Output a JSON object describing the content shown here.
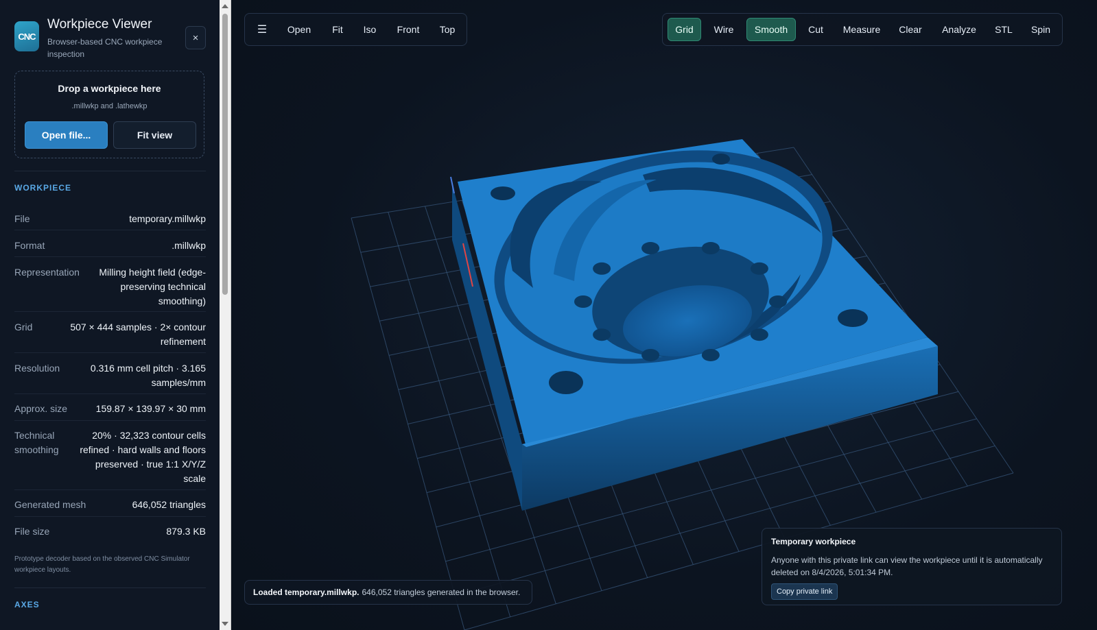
{
  "app": {
    "logo_text": "CNC",
    "title": "Workpiece Viewer",
    "subtitle": "Browser-based CNC workpiece inspection",
    "close_symbol": "×"
  },
  "dropzone": {
    "title": "Drop a workpiece here",
    "subtitle": ".millwkp and .lathewkp",
    "open_label": "Open file...",
    "fit_label": "Fit view"
  },
  "workpiece": {
    "heading": "WORKPIECE",
    "rows": [
      {
        "key": "File",
        "value": "temporary.millwkp"
      },
      {
        "key": "Format",
        "value": ".millwkp"
      },
      {
        "key": "Representation",
        "value": "Milling height field (edge-preserving technical smoothing)"
      },
      {
        "key": "Grid",
        "value": "507 × 444 samples · 2× contour refinement"
      },
      {
        "key": "Resolution",
        "value": "0.316 mm cell pitch · 3.165 samples/mm"
      },
      {
        "key": "Approx. size",
        "value": "159.87 × 139.97 × 30 mm"
      },
      {
        "key": "Technical smoothing",
        "value": "20% · 32,323 contour cells refined · hard walls and floors preserved · true 1:1 X/Y/Z scale"
      },
      {
        "key": "Generated mesh",
        "value": "646,052 triangles"
      },
      {
        "key": "File size",
        "value": "879.3 KB"
      }
    ],
    "note": "Prototype decoder based on the observed CNC Simulator workpiece layouts."
  },
  "axes": {
    "heading": "AXES"
  },
  "toolbar_left": {
    "menu_icon": "☰",
    "items": [
      "Open",
      "Fit",
      "Iso",
      "Front",
      "Top"
    ]
  },
  "toolbar_right": {
    "items": [
      {
        "label": "Grid",
        "active": true
      },
      {
        "label": "Wire",
        "active": false
      },
      {
        "label": "Smooth",
        "active": true
      },
      {
        "label": "Cut",
        "active": false
      },
      {
        "label": "Measure",
        "active": false
      },
      {
        "label": "Clear",
        "active": false
      },
      {
        "label": "Analyze",
        "active": false
      },
      {
        "label": "STL",
        "active": false
      },
      {
        "label": "Spin",
        "active": false
      }
    ]
  },
  "status": {
    "bold": "Loaded temporary.millwkp.",
    "text": "646,052 triangles generated in the browser."
  },
  "temp_card": {
    "title": "Temporary workpiece",
    "body": "Anyone with this private link can view the workpiece until it is automatically deleted on 8/4/2026, 5:01:34 PM.",
    "button": "Copy private link"
  },
  "colors": {
    "accent": "#2a7fc0",
    "active_toggle": "#1e5a4e",
    "workpiece": "#1f7fcc",
    "grid_line": "#3a5a80"
  }
}
